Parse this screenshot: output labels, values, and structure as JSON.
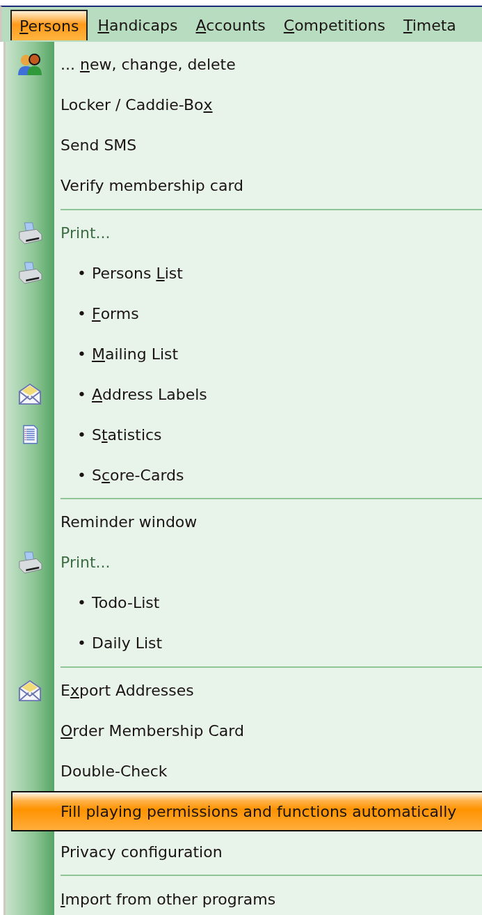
{
  "menu_bar": [
    {
      "label": [
        {
          "text": "P",
          "access_key": true
        },
        {
          "text": "ersons"
        }
      ],
      "selected": true
    },
    {
      "label": [
        {
          "text": "H",
          "access_key": true
        },
        {
          "text": "andicaps"
        }
      ],
      "selected": false
    },
    {
      "label": [
        {
          "text": "A",
          "access_key": true
        },
        {
          "text": "ccounts"
        }
      ],
      "selected": false
    },
    {
      "label": [
        {
          "text": "C",
          "access_key": true
        },
        {
          "text": "ompetitions"
        }
      ],
      "selected": false
    },
    {
      "label": [
        {
          "text": "T",
          "access_key": true
        },
        {
          "text": "imeta"
        }
      ],
      "selected": false
    }
  ],
  "menu": [
    {
      "kind": "command",
      "label": [
        {
          "text": "... "
        },
        {
          "text": "n",
          "access_key": true
        },
        {
          "text": "ew, change, delete"
        }
      ],
      "selected": false
    },
    {
      "kind": "command",
      "label": [
        {
          "text": "Locker / Caddie-Bo"
        },
        {
          "text": "x",
          "access_key": true
        }
      ],
      "selected": false
    },
    {
      "kind": "command",
      "label": [
        {
          "text": "Send SMS"
        }
      ],
      "selected": false
    },
    {
      "kind": "command",
      "label": [
        {
          "text": "Verify membership card"
        }
      ],
      "selected": false
    },
    {
      "kind": "separator"
    },
    {
      "kind": "header",
      "label": [
        {
          "text": "Print..."
        }
      ]
    },
    {
      "kind": "subitem",
      "bullet": "•",
      "label": [
        {
          "text": "Persons "
        },
        {
          "text": "L",
          "access_key": true
        },
        {
          "text": "ist"
        }
      ],
      "selected": false
    },
    {
      "kind": "subitem",
      "bullet": "•",
      "label": [
        {
          "text": "F",
          "access_key": true
        },
        {
          "text": "orms"
        }
      ],
      "selected": false
    },
    {
      "kind": "subitem",
      "bullet": "•",
      "label": [
        {
          "text": "M",
          "access_key": true
        },
        {
          "text": "ailing List"
        }
      ],
      "selected": false
    },
    {
      "kind": "subitem",
      "bullet": "•",
      "label": [
        {
          "text": "A",
          "access_key": true
        },
        {
          "text": "ddress Labels"
        }
      ],
      "selected": false
    },
    {
      "kind": "subitem",
      "bullet": "•",
      "label": [
        {
          "text": "S"
        },
        {
          "text": "t",
          "access_key": true
        },
        {
          "text": "atistics"
        }
      ],
      "selected": false
    },
    {
      "kind": "subitem",
      "bullet": "•",
      "label": [
        {
          "text": "S"
        },
        {
          "text": "c",
          "access_key": true
        },
        {
          "text": "ore-Cards"
        }
      ],
      "selected": false
    },
    {
      "kind": "separator"
    },
    {
      "kind": "command",
      "label": [
        {
          "text": "Reminder window"
        }
      ],
      "selected": false
    },
    {
      "kind": "header",
      "label": [
        {
          "text": "Print..."
        }
      ]
    },
    {
      "kind": "subitem",
      "bullet": "•",
      "label": [
        {
          "text": "Todo-List"
        }
      ],
      "selected": false
    },
    {
      "kind": "subitem",
      "bullet": "•",
      "label": [
        {
          "text": "Daily List"
        }
      ],
      "selected": false
    },
    {
      "kind": "separator"
    },
    {
      "kind": "command",
      "label": [
        {
          "text": "E"
        },
        {
          "text": "x",
          "access_key": true
        },
        {
          "text": "port Addresses"
        }
      ],
      "selected": false
    },
    {
      "kind": "command",
      "label": [
        {
          "text": "O",
          "access_key": true
        },
        {
          "text": "rder Membership Card"
        }
      ],
      "selected": false
    },
    {
      "kind": "command",
      "label": [
        {
          "text": "Double-Check"
        }
      ],
      "selected": false
    },
    {
      "kind": "command",
      "label": [
        {
          "text": "Fill playing permissions and functions automatically"
        }
      ],
      "selected": true
    },
    {
      "kind": "command",
      "label": [
        {
          "text": "Privacy configuration"
        }
      ],
      "selected": false
    },
    {
      "kind": "separator"
    },
    {
      "kind": "command",
      "label": [
        {
          "text": "I",
          "access_key": true
        },
        {
          "text": "mport from other programs"
        }
      ],
      "selected": false
    }
  ]
}
